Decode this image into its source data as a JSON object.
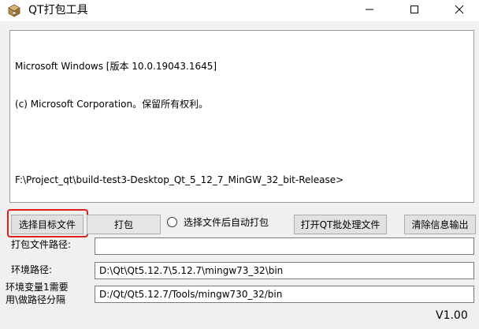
{
  "window": {
    "title": "QT打包工具",
    "icon": "box-icon",
    "controls": [
      "minimize-icon",
      "maximize-icon",
      "close-icon"
    ]
  },
  "console": {
    "lines": [
      "Microsoft Windows [版本 10.0.19043.1645]",
      "(c) Microsoft Corporation。保留所有权利。",
      "",
      "F:\\Project_qt\\build-test3-Desktop_Qt_5_12_7_MinGW_32_bit-Release>"
    ]
  },
  "toolbar": {
    "select_target": "选择目标文件",
    "pack": "打包",
    "auto_pack_radio": "选择文件后自动打包",
    "open_batch": "打开QT批处理文件",
    "clear_output": "清除信息输出"
  },
  "form": {
    "pack_path_label": "打包文件路径:",
    "pack_path_value": "",
    "env_path_label": "环境路径:",
    "env_path_value": "D:\\Qt\\Qt5.12.7\\5.12.7\\mingw73_32\\bin",
    "env_var_label_line1": "环境变量1需要",
    "env_var_label_line2": "用\\做路径分隔",
    "env_var_value": "D:/Qt/Qt5.12.7/Tools/mingw730_32/bin"
  },
  "version": "V1.00",
  "colors": {
    "highlight": "#e02020",
    "button_bg": "#e1e1e1",
    "window_bg": "#f0f0f0"
  }
}
